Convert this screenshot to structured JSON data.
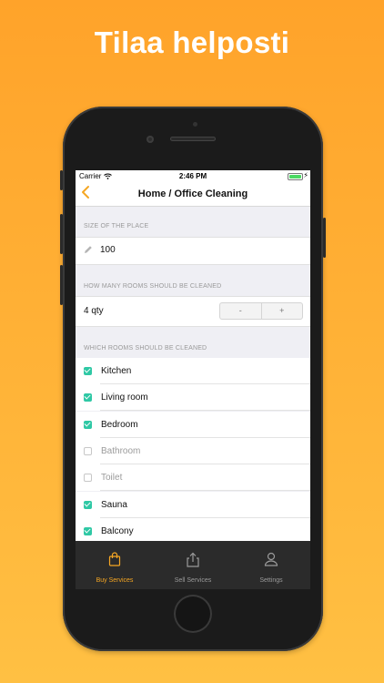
{
  "headline": "Tilaa helposti",
  "status_bar": {
    "carrier": "Carrier",
    "time": "2:46 PM"
  },
  "nav": {
    "title": "Home / Office Cleaning"
  },
  "size_section": {
    "label": "SIZE OF THE PLACE",
    "value": "100"
  },
  "rooms_count_section": {
    "label": "HOW MANY ROOMS SHOULD BE CLEANED",
    "value": "4 qty",
    "decrement": "-",
    "increment": "+"
  },
  "rooms_section": {
    "label": "WHICH ROOMS SHOULD BE CLEANED",
    "items": [
      {
        "label": "Kitchen",
        "checked": true
      },
      {
        "label": "Living room",
        "checked": true
      },
      {
        "label": "Bedroom",
        "checked": true
      },
      {
        "label": "Bathroom",
        "checked": false
      },
      {
        "label": "Toilet",
        "checked": false
      },
      {
        "label": "Sauna",
        "checked": true
      },
      {
        "label": "Balcony",
        "checked": true
      }
    ]
  },
  "tabs": [
    {
      "label": "Buy Services",
      "icon": "shopping-bag-icon",
      "active": true
    },
    {
      "label": "Sell Services",
      "icon": "share-icon",
      "active": false
    },
    {
      "label": "Settings",
      "icon": "user-icon",
      "active": false
    }
  ],
  "colors": {
    "accent": "#f5a623",
    "check": "#2fc8a5",
    "tab_bar": "#2b2b2b",
    "background_top": "#ffa32a",
    "background_bottom": "#ffc043"
  }
}
